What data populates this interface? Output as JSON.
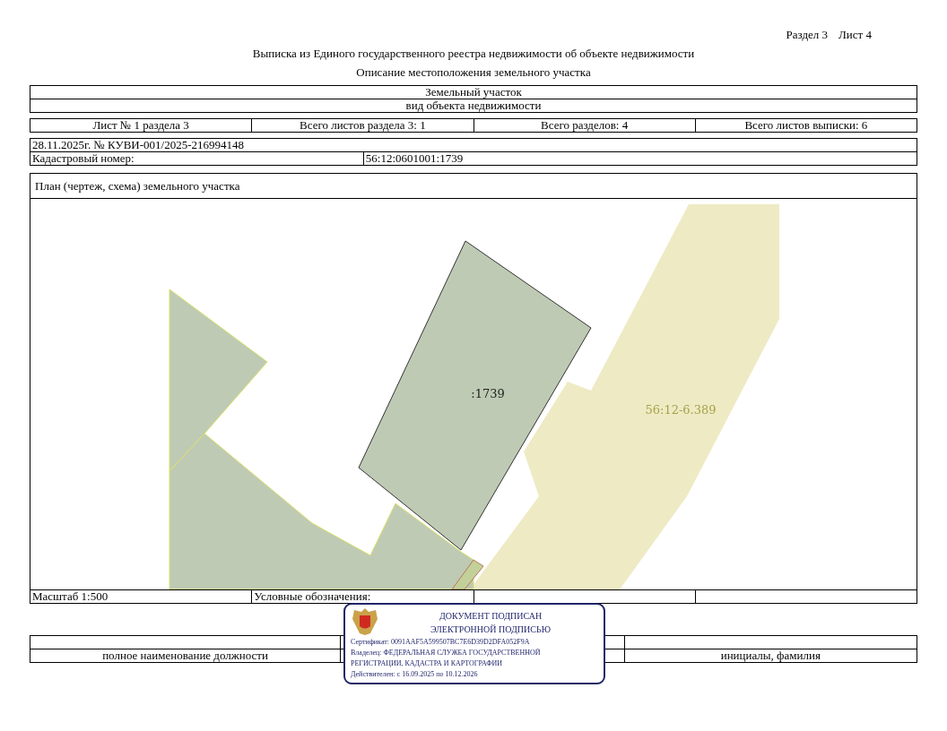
{
  "header": {
    "section": "Раздел 3",
    "sheet": "Лист 4",
    "title": "Выписка из Единого государственного реестра недвижимости об объекте недвижимости",
    "subtitle": "Описание местоположения земельного участка"
  },
  "object": {
    "type": "Земельный участок",
    "caption": "вид объекта недвижимости"
  },
  "sheet_info": [
    "Лист № 1 раздела 3",
    "Всего листов раздела 3: 1",
    "Всего разделов: 4",
    "Всего листов выписки: 6"
  ],
  "record": {
    "date_number": "28.11.2025г. № КУВИ-001/2025-216994148",
    "cadastral_label": "Кадастровый номер:",
    "cadastral_number": "56:12:0601001:1739"
  },
  "plan": {
    "title": "План (чертеж, схема) земельного участка",
    "labels": [
      {
        "kind": "plot",
        "text": ":1739"
      },
      {
        "kind": "zone",
        "text": "56:12-6.389"
      }
    ]
  },
  "legend": {
    "scale": "Масштаб 1:500",
    "label": "Условные обозначения:"
  },
  "signature": {
    "position_caption": "полное наименование должности",
    "name_caption": "инициалы, фамилия"
  },
  "stamp": {
    "title_1": "ДОКУМЕНТ ПОДПИСАН",
    "title_2": "ЭЛЕКТРОННОЙ ПОДПИСЬЮ",
    "certificate": "Сертификат: 0091AAF5A599507BC7E6D39D2DFA052F9A",
    "owner_1": "Владелец: ФЕДЕРАЛЬНАЯ СЛУЖБА ГОСУДАРСТВЕННОЙ",
    "owner_2": "РЕГИСТРАЦИИ, КАДАСТРА И КАРТОГРАФИИ",
    "validity": "Действителен: с 16.09.2025 по 10.12.2026"
  }
}
